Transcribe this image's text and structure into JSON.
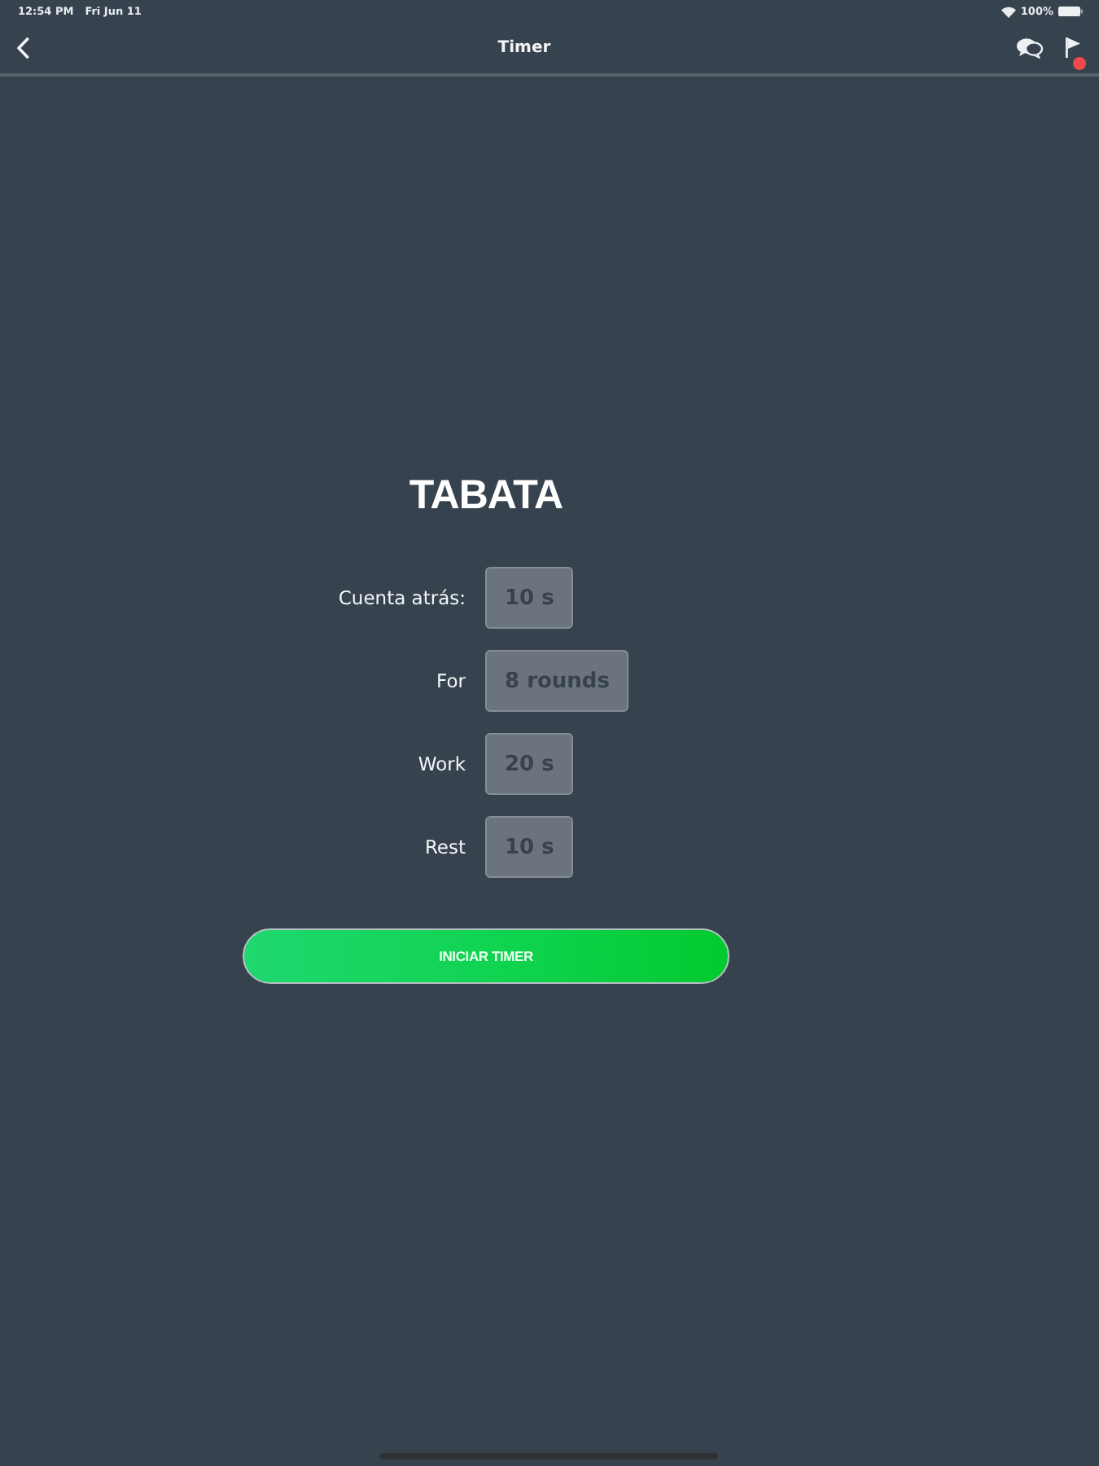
{
  "status_bar": {
    "time": "12:54 PM",
    "date": "Fri Jun 11",
    "battery": "100%"
  },
  "header": {
    "title": "Timer",
    "notification_badge": true
  },
  "timer": {
    "title": "TABATA",
    "settings": [
      {
        "label": "Cuenta atrás:",
        "value": "10 s"
      },
      {
        "label": "For",
        "value": "8 rounds"
      },
      {
        "label": "Work",
        "value": "20 s"
      },
      {
        "label": "Rest",
        "value": "10 s"
      }
    ]
  },
  "start_button": {
    "label": "INICIAR TIMER"
  }
}
